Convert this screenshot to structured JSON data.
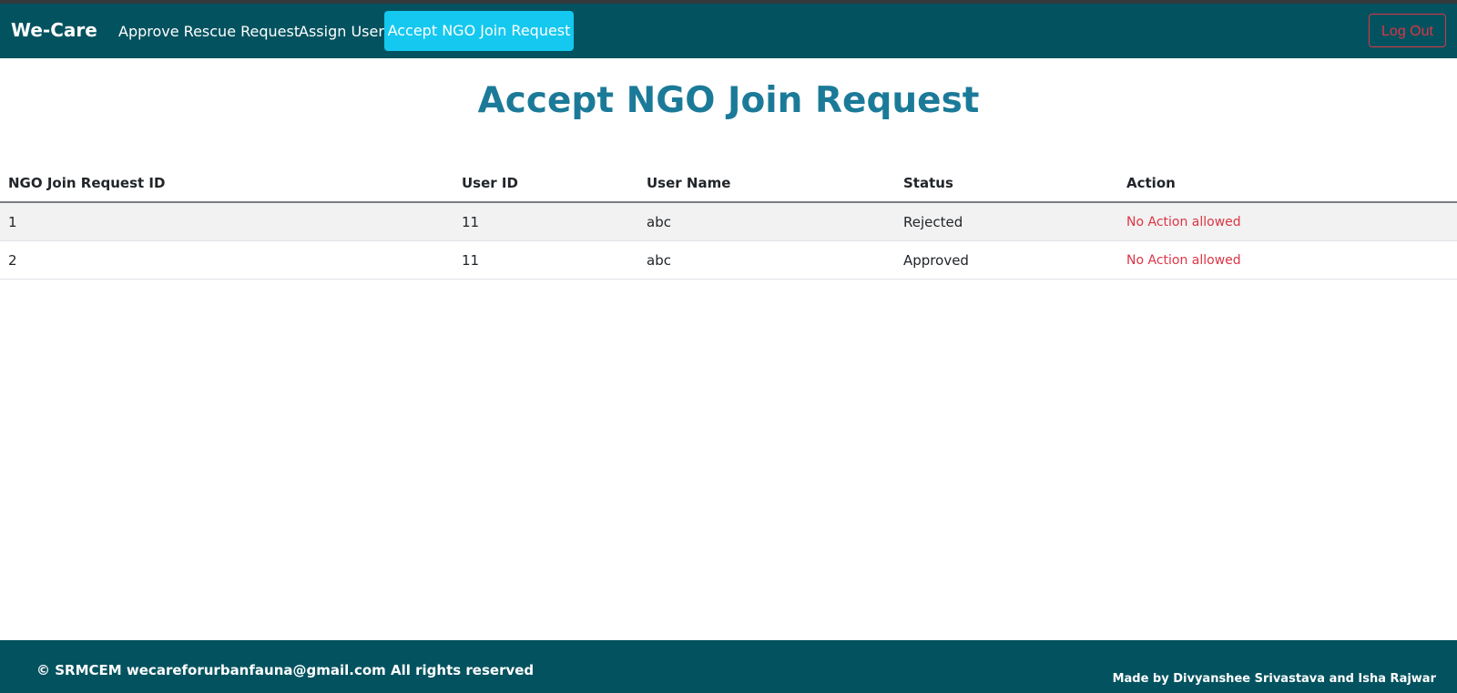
{
  "navbar": {
    "brand": "We-Care",
    "links": [
      {
        "label": "Approve Rescue Request"
      },
      {
        "label": "Assign User"
      }
    ],
    "active_link": "Accept NGO Join Request",
    "logout_label": "Log Out"
  },
  "page": {
    "title": "Accept NGO Join Request"
  },
  "table": {
    "headers": [
      "NGO Join Request ID",
      "User ID",
      "User Name",
      "Status",
      "Action"
    ],
    "rows": [
      {
        "id": "1",
        "user_id": "11",
        "user_name": "abc",
        "status": "Rejected",
        "action": "No Action allowed"
      },
      {
        "id": "2",
        "user_id": "11",
        "user_name": "abc",
        "status": "Approved",
        "action": "No Action allowed"
      }
    ]
  },
  "footer": {
    "copyright": "© SRMCEM wecareforurbanfauna@gmail.com All rights reserved",
    "made_by": "Made by Divyanshee Srivastava and Isha Rajwar"
  },
  "colors": {
    "navbar_bg": "#03525f",
    "active_link_bg": "#14c8ef",
    "title": "#1c7a99",
    "danger": "#dc3545"
  }
}
